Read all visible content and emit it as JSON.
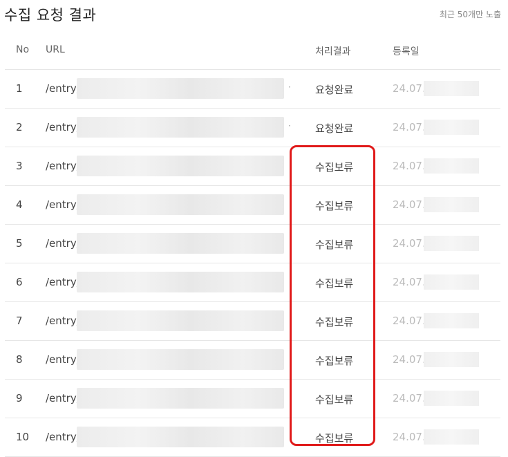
{
  "header": {
    "title": "수집 요청 결과",
    "note": "최근 50개만 노출"
  },
  "table": {
    "columns": {
      "no": "No",
      "url": "URL",
      "result": "처리결과",
      "date": "등록일"
    },
    "rows": [
      {
        "no": "1",
        "url": "/entry/",
        "result": "요청완료",
        "date": "24.07."
      },
      {
        "no": "2",
        "url": "/entry/",
        "result": "요청완료",
        "date": "24.07."
      },
      {
        "no": "3",
        "url": "/entry/",
        "result": "수집보류",
        "date": "24.07."
      },
      {
        "no": "4",
        "url": "/entry/",
        "result": "수집보류",
        "date": "24.07."
      },
      {
        "no": "5",
        "url": "/entry/",
        "result": "수집보류",
        "date": "24.07."
      },
      {
        "no": "6",
        "url": "/entry/",
        "result": "수집보류",
        "date": "24.07."
      },
      {
        "no": "7",
        "url": "/entry/",
        "result": "수집보류",
        "date": "24.07."
      },
      {
        "no": "8",
        "url": "/entry/",
        "result": "수집보류",
        "date": "24.07."
      },
      {
        "no": "9",
        "url": "/entry/",
        "result": "수집보류",
        "date": "24.07."
      },
      {
        "no": "10",
        "url": "/entry/",
        "result": "수집보류",
        "date": "24.07."
      }
    ]
  },
  "colors": {
    "highlight_border": "#e01a1a",
    "date_text": "#bbbbbb"
  }
}
